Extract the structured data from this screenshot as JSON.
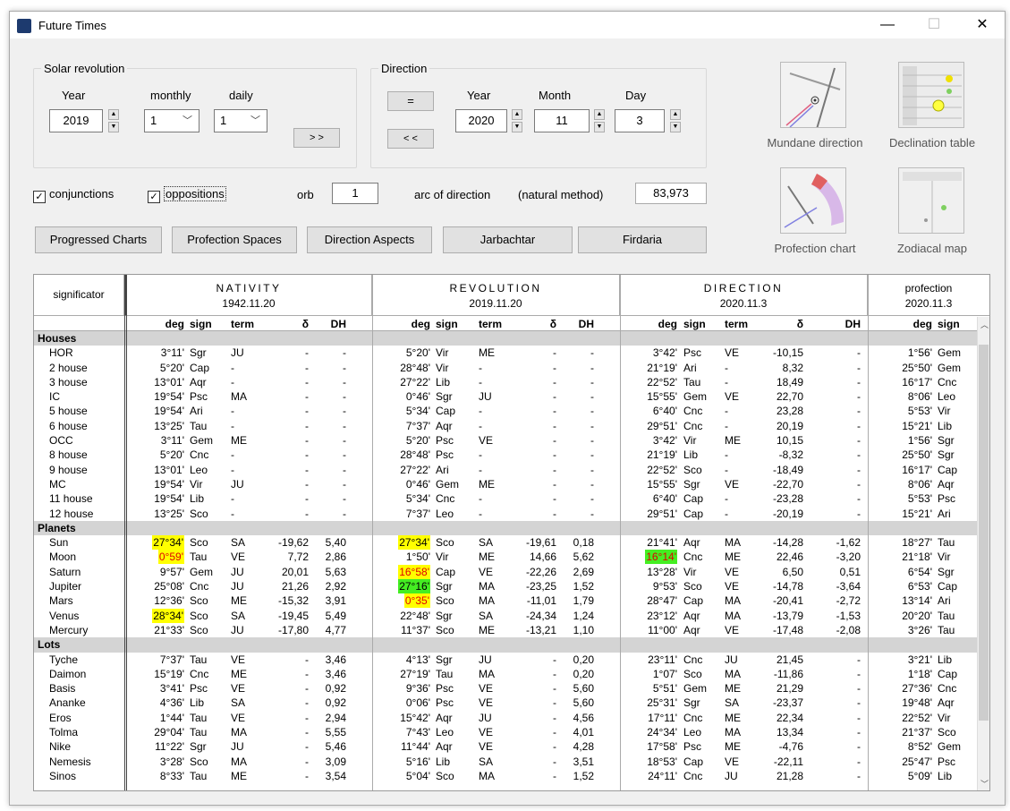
{
  "window": {
    "title": "Future Times",
    "minimize": "—",
    "maximize": "☐",
    "close": "✕"
  },
  "solar_revolution": {
    "legend": "Solar revolution",
    "year_label": "Year",
    "monthly_label": "monthly",
    "daily_label": "daily",
    "year": "2019",
    "monthly": "1",
    "daily": "1",
    "go_label": "> >"
  },
  "direction": {
    "legend": "Direction",
    "equals_label": "=",
    "back_label": "< <",
    "year_label": "Year",
    "month_label": "Month",
    "day_label": "Day",
    "year": "2020",
    "month": "11",
    "day": "3"
  },
  "options": {
    "conjunctions": "conjunctions",
    "oppositions": "oppositions",
    "orb_label": "orb",
    "orb": "1",
    "arc_label": "arc of direction",
    "method_label": "(natural method)",
    "arc_value": "83,973"
  },
  "buttons": [
    "Progressed Charts",
    "Profection Spaces",
    "Direction Aspects",
    "Jarbachtar",
    "Firdaria"
  ],
  "tools": [
    "Mundane direction",
    "Declination table",
    "Profection chart",
    "Zodiacal map"
  ],
  "table": {
    "significator_label": "significator",
    "groups": [
      {
        "title": "NATIVITY",
        "date": "1942.11.20"
      },
      {
        "title": "REVOLUTION",
        "date": "2019.11.20"
      },
      {
        "title": "DIRECTION",
        "date": "2020.11.3"
      },
      {
        "title": "profection",
        "date": "2020.11.3"
      }
    ],
    "col_headers": [
      "deg",
      "sign",
      "term",
      "δ",
      "DH",
      "deg",
      "sign",
      "term",
      "δ",
      "DH",
      "deg",
      "sign",
      "term",
      "δ",
      "DH",
      "deg",
      "sign"
    ],
    "rows": [
      {
        "s": "Houses"
      },
      {
        "n": "HOR",
        "c": [
          "3°11'",
          "Sgr",
          "JU",
          "-",
          "-",
          "5°20'",
          "Vir",
          "ME",
          "-",
          "-",
          "3°42'",
          "Psc",
          "VE",
          "-10,15",
          "-",
          "1°56'",
          "Gem"
        ]
      },
      {
        "n": "2 house",
        "c": [
          "5°20'",
          "Cap",
          "-",
          "-",
          "-",
          "28°48'",
          "Vir",
          "-",
          "-",
          "-",
          "21°19'",
          "Ari",
          "-",
          "8,32",
          "-",
          "25°50'",
          "Gem"
        ]
      },
      {
        "n": "3 house",
        "c": [
          "13°01'",
          "Aqr",
          "-",
          "-",
          "-",
          "27°22'",
          "Lib",
          "-",
          "-",
          "-",
          "22°52'",
          "Tau",
          "-",
          "18,49",
          "-",
          "16°17'",
          "Cnc"
        ]
      },
      {
        "n": "IC",
        "c": [
          "19°54'",
          "Psc",
          "MA",
          "-",
          "-",
          "0°46'",
          "Sgr",
          "JU",
          "-",
          "-",
          "15°55'",
          "Gem",
          "VE",
          "22,70",
          "-",
          "8°06'",
          "Leo"
        ]
      },
      {
        "n": "5 house",
        "c": [
          "19°54'",
          "Ari",
          "-",
          "-",
          "-",
          "5°34'",
          "Cap",
          "-",
          "-",
          "-",
          "6°40'",
          "Cnc",
          "-",
          "23,28",
          "-",
          "5°53'",
          "Vir"
        ]
      },
      {
        "n": "6 house",
        "c": [
          "13°25'",
          "Tau",
          "-",
          "-",
          "-",
          "7°37'",
          "Aqr",
          "-",
          "-",
          "-",
          "29°51'",
          "Cnc",
          "-",
          "20,19",
          "-",
          "15°21'",
          "Lib"
        ]
      },
      {
        "n": "OCC",
        "c": [
          "3°11'",
          "Gem",
          "ME",
          "-",
          "-",
          "5°20'",
          "Psc",
          "VE",
          "-",
          "-",
          "3°42'",
          "Vir",
          "ME",
          "10,15",
          "-",
          "1°56'",
          "Sgr"
        ]
      },
      {
        "n": "8 house",
        "c": [
          "5°20'",
          "Cnc",
          "-",
          "-",
          "-",
          "28°48'",
          "Psc",
          "-",
          "-",
          "-",
          "21°19'",
          "Lib",
          "-",
          "-8,32",
          "-",
          "25°50'",
          "Sgr"
        ]
      },
      {
        "n": "9 house",
        "c": [
          "13°01'",
          "Leo",
          "-",
          "-",
          "-",
          "27°22'",
          "Ari",
          "-",
          "-",
          "-",
          "22°52'",
          "Sco",
          "-",
          "-18,49",
          "-",
          "16°17'",
          "Cap"
        ]
      },
      {
        "n": "MC",
        "c": [
          "19°54'",
          "Vir",
          "JU",
          "-",
          "-",
          "0°46'",
          "Gem",
          "ME",
          "-",
          "-",
          "15°55'",
          "Sgr",
          "VE",
          "-22,70",
          "-",
          "8°06'",
          "Aqr"
        ]
      },
      {
        "n": "11 house",
        "c": [
          "19°54'",
          "Lib",
          "-",
          "-",
          "-",
          "5°34'",
          "Cnc",
          "-",
          "-",
          "-",
          "6°40'",
          "Cap",
          "-",
          "-23,28",
          "-",
          "5°53'",
          "Psc"
        ]
      },
      {
        "n": "12 house",
        "c": [
          "13°25'",
          "Sco",
          "-",
          "-",
          "-",
          "7°37'",
          "Leo",
          "-",
          "-",
          "-",
          "29°51'",
          "Cap",
          "-",
          "-20,19",
          "-",
          "15°21'",
          "Ari"
        ]
      },
      {
        "s": "Planets"
      },
      {
        "n": "Sun",
        "c": [
          "27°34'",
          "Sco",
          "SA",
          "-19,62",
          "5,40",
          "27°34'",
          "Sco",
          "SA",
          "-19,61",
          "0,18",
          "21°41'",
          "Aqr",
          "MA",
          "-14,28",
          "-1,62",
          "18°27'",
          "Tau"
        ],
        "h": {
          "0": "hy",
          "5": "hy"
        }
      },
      {
        "n": "Moon",
        "c": [
          "0°59'",
          "Tau",
          "VE",
          "7,72",
          "2,86",
          "1°50'",
          "Vir",
          "ME",
          "14,66",
          "5,62",
          "16°14'",
          "Cnc",
          "ME",
          "22,46",
          "-3,20",
          "21°18'",
          "Vir"
        ],
        "h": {
          "0": "hyr",
          "10": "hgr"
        }
      },
      {
        "n": "Saturn",
        "c": [
          "9°57'",
          "Gem",
          "JU",
          "20,01",
          "5,63",
          "16°58'",
          "Cap",
          "VE",
          "-22,26",
          "2,69",
          "13°28'",
          "Vir",
          "VE",
          "6,50",
          "0,51",
          "6°54'",
          "Sgr"
        ],
        "h": {
          "5": "hyr"
        }
      },
      {
        "n": "Jupiter",
        "c": [
          "25°08'",
          "Cnc",
          "JU",
          "21,26",
          "2,92",
          "27°16'",
          "Sgr",
          "MA",
          "-23,25",
          "1,52",
          "9°53'",
          "Sco",
          "VE",
          "-14,78",
          "-3,64",
          "6°53'",
          "Cap"
        ],
        "h": {
          "5": "hg"
        }
      },
      {
        "n": "Mars",
        "c": [
          "12°36'",
          "Sco",
          "ME",
          "-15,32",
          "3,91",
          "0°35'",
          "Sco",
          "MA",
          "-11,01",
          "1,79",
          "28°47'",
          "Cap",
          "MA",
          "-20,41",
          "-2,72",
          "13°14'",
          "Ari"
        ],
        "h": {
          "5": "hyr"
        }
      },
      {
        "n": "Venus",
        "c": [
          "28°34'",
          "Sco",
          "SA",
          "-19,45",
          "5,49",
          "22°48'",
          "Sgr",
          "SA",
          "-24,34",
          "1,24",
          "23°12'",
          "Aqr",
          "MA",
          "-13,79",
          "-1,53",
          "20°20'",
          "Tau"
        ],
        "h": {
          "0": "hy"
        }
      },
      {
        "n": "Mercury",
        "c": [
          "21°33'",
          "Sco",
          "JU",
          "-17,80",
          "4,77",
          "11°37'",
          "Sco",
          "ME",
          "-13,21",
          "1,10",
          "11°00'",
          "Aqr",
          "VE",
          "-17,48",
          "-2,08",
          "3°26'",
          "Tau"
        ]
      },
      {
        "s": "Lots"
      },
      {
        "n": "Tyche",
        "c": [
          "7°37'",
          "Tau",
          "VE",
          "-",
          "3,46",
          "4°13'",
          "Sgr",
          "JU",
          "-",
          "0,20",
          "23°11'",
          "Cnc",
          "JU",
          "21,45",
          "-",
          "3°21'",
          "Lib"
        ]
      },
      {
        "n": "Daimon",
        "c": [
          "15°19'",
          "Cnc",
          "ME",
          "-",
          "3,46",
          "27°19'",
          "Tau",
          "MA",
          "-",
          "0,20",
          "1°07'",
          "Sco",
          "MA",
          "-11,86",
          "-",
          "1°18'",
          "Cap"
        ]
      },
      {
        "n": "Basis",
        "c": [
          "3°41'",
          "Psc",
          "VE",
          "-",
          "0,92",
          "9°36'",
          "Psc",
          "VE",
          "-",
          "5,60",
          "5°51'",
          "Gem",
          "ME",
          "21,29",
          "-",
          "27°36'",
          "Cnc"
        ]
      },
      {
        "n": "Ananke",
        "c": [
          "4°36'",
          "Lib",
          "SA",
          "-",
          "0,92",
          "0°06'",
          "Psc",
          "VE",
          "-",
          "5,60",
          "25°31'",
          "Sgr",
          "SA",
          "-23,37",
          "-",
          "19°48'",
          "Aqr"
        ]
      },
      {
        "n": "Eros",
        "c": [
          "1°44'",
          "Tau",
          "VE",
          "-",
          "2,94",
          "15°42'",
          "Aqr",
          "JU",
          "-",
          "4,56",
          "17°11'",
          "Cnc",
          "ME",
          "22,34",
          "-",
          "22°52'",
          "Vir"
        ]
      },
      {
        "n": "Tolma",
        "c": [
          "29°04'",
          "Tau",
          "MA",
          "-",
          "5,55",
          "7°43'",
          "Leo",
          "VE",
          "-",
          "4,01",
          "24°34'",
          "Leo",
          "MA",
          "13,34",
          "-",
          "21°37'",
          "Sco"
        ]
      },
      {
        "n": "Nike",
        "c": [
          "11°22'",
          "Sgr",
          "JU",
          "-",
          "5,46",
          "11°44'",
          "Aqr",
          "VE",
          "-",
          "4,28",
          "17°58'",
          "Psc",
          "ME",
          "-4,76",
          "-",
          "8°52'",
          "Gem"
        ]
      },
      {
        "n": "Nemesis",
        "c": [
          "3°28'",
          "Sco",
          "MA",
          "-",
          "3,09",
          "5°16'",
          "Lib",
          "SA",
          "-",
          "3,51",
          "18°53'",
          "Cap",
          "VE",
          "-22,11",
          "-",
          "25°47'",
          "Psc"
        ]
      },
      {
        "n": "Sinos",
        "c": [
          "8°33'",
          "Tau",
          "ME",
          "-",
          "3,54",
          "5°04'",
          "Sco",
          "MA",
          "-",
          "1,52",
          "24°11'",
          "Cnc",
          "JU",
          "21,28",
          "-",
          "5°09'",
          "Lib"
        ]
      }
    ]
  }
}
